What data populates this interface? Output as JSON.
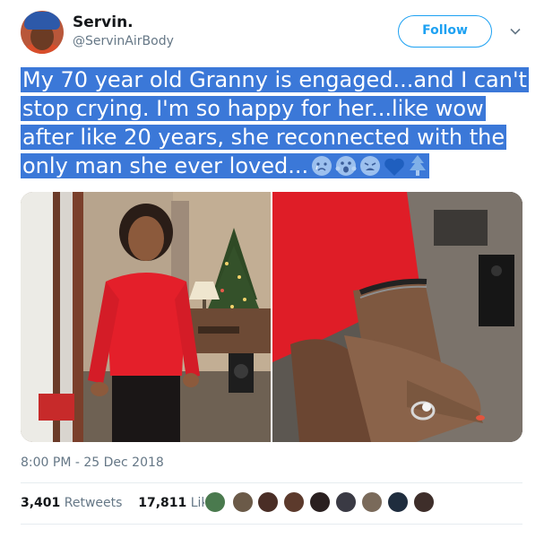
{
  "user": {
    "display_name": "Servin.",
    "handle": "@ServinAirBody"
  },
  "follow_label": "Follow",
  "tweet": {
    "lines": [
      "My 70 year old Granny is engaged...and I can't",
      "stop crying. I'm so happy for her...like wow",
      "after like 20 years, she reconnected with the",
      "only man she ever loved..."
    ],
    "emojis": [
      "crying-face",
      "face-screaming-in-fear",
      "weary-face",
      "blue-heart",
      "christmas-tree"
    ]
  },
  "media": [
    {
      "name": "photo-granny-red-sweater"
    },
    {
      "name": "photo-engagement-ring-hand"
    }
  ],
  "timestamp": "8:00 PM - 25 Dec 2018",
  "stats": {
    "retweets_count": "3,401",
    "retweets_label": "Retweets",
    "likes_count": "17,811",
    "likes_label": "Likes"
  },
  "colors": {
    "accent": "#1da1f2",
    "selection": "#3b78d8",
    "secondary_text": "#657786"
  }
}
